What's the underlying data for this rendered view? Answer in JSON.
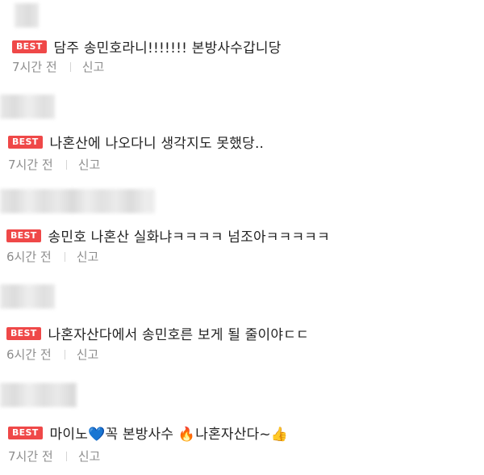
{
  "badge_label": "BEST",
  "comments": [
    {
      "text": "담주 송민호라니!!!!!!! 본방사수갑니당",
      "time": "7시간 전",
      "report_label": "신고"
    },
    {
      "text": "나혼산에 나오다니 생각지도 못했당..",
      "time": "7시간 전",
      "report_label": "신고"
    },
    {
      "text": "송민호 나혼산 실화냐ㅋㅋㅋㅋ 넘조아ㅋㅋㅋㅋㅋ",
      "time": "6시간 전",
      "report_label": "신고"
    },
    {
      "text": "나혼자산다에서 송민호른 보게 될 줄이야ㄷㄷ",
      "time": "6시간 전",
      "report_label": "신고"
    },
    {
      "text_part1": "마이노",
      "emoji1": "💙",
      "text_part2": "꼭 본방사수 ",
      "emoji2": "🔥",
      "text_part3": "나혼자산다~",
      "emoji3": "👍",
      "time": "7시간 전",
      "report_label": "신고"
    }
  ],
  "colors": {
    "badge": "#ef4848",
    "text": "#222222",
    "meta": "#8d8d8d"
  }
}
